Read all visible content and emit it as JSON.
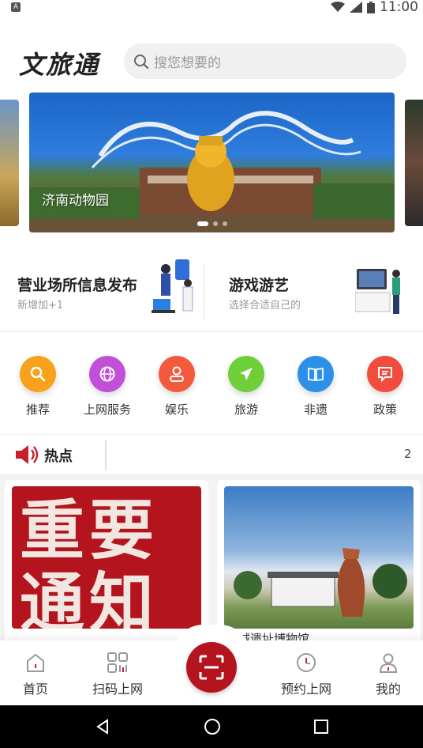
{
  "status": {
    "time": "11:00"
  },
  "header": {
    "logo": "文旅通",
    "search_placeholder": "搜您想要的"
  },
  "banner": {
    "caption": "济南动物园"
  },
  "promo": [
    {
      "title": "营业场所信息发布",
      "subtitle": "新增加+1"
    },
    {
      "title": "游戏游艺",
      "subtitle": "选择合适自己的"
    }
  ],
  "categories": [
    {
      "label": "推荐",
      "color": "#f8a21c"
    },
    {
      "label": "上网服务",
      "color": "#c24fd8"
    },
    {
      "label": "娱乐",
      "color": "#f25a3e"
    },
    {
      "label": "旅游",
      "color": "#6fcf3b"
    },
    {
      "label": "非遗",
      "color": "#2c8fe8"
    },
    {
      "label": "政策",
      "color": "#f24d3c"
    }
  ],
  "hot": {
    "title": "热点",
    "scroll_text": "2"
  },
  "feed": [
    {
      "image_text": "重要通知",
      "caption": ""
    },
    {
      "image_text": "",
      "caption": "…城遗址博物馆"
    }
  ],
  "tabbar": {
    "home": "首页",
    "scan": "扫码上网",
    "reserve": "预约上网",
    "mine": "我的"
  },
  "colors": {
    "brand": "#b3141d",
    "accent_red": "#c8202b"
  }
}
